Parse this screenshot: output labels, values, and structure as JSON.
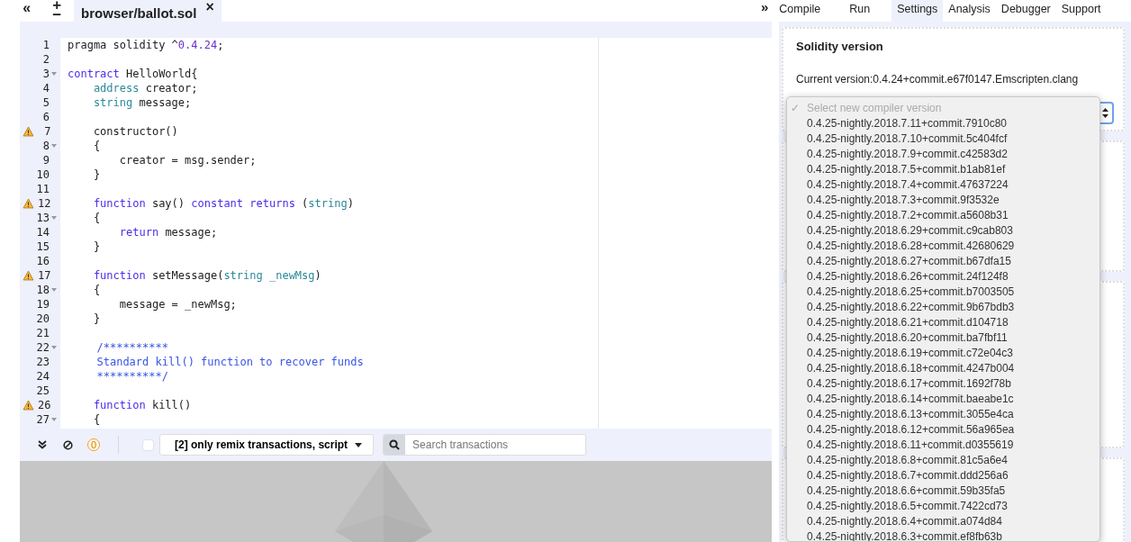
{
  "editor_toolbar": {
    "collapse": "«",
    "add": "+",
    "remove": "−"
  },
  "file_tab": {
    "label": "browser/ballot.sol",
    "close": "×",
    "selected": true
  },
  "code": [
    {
      "number": "1",
      "warning": false,
      "foldable": false,
      "tokens": [
        {
          "kind": "plain",
          "text": "pragma solidity ^"
        },
        {
          "kind": "number",
          "text": "0.4.24"
        },
        {
          "kind": "plain",
          "text": ";"
        }
      ]
    },
    {
      "number": "2",
      "warning": false,
      "foldable": false
    },
    {
      "number": "3",
      "warning": false,
      "foldable": true,
      "tokens": [
        {
          "kind": "keyword",
          "text": "contract"
        },
        {
          "kind": "plain",
          "text": " HelloWorld{"
        }
      ]
    },
    {
      "number": "4",
      "warning": false,
      "foldable": false,
      "tokens": [
        {
          "kind": "type",
          "text": "address"
        },
        {
          "kind": "plain",
          "text": " creator;"
        }
      ]
    },
    {
      "number": "5",
      "warning": false,
      "foldable": false,
      "tokens": [
        {
          "kind": "type",
          "text": "string"
        },
        {
          "kind": "plain",
          "text": " message;"
        }
      ]
    },
    {
      "number": "6",
      "warning": false,
      "foldable": false
    },
    {
      "number": "7",
      "warning": true,
      "foldable": false,
      "tokens": [
        {
          "kind": "plain",
          "text": "constructor()"
        }
      ]
    },
    {
      "number": "8",
      "warning": false,
      "foldable": true,
      "tokens": [
        {
          "kind": "plain",
          "text": "{"
        }
      ]
    },
    {
      "number": "9",
      "warning": false,
      "foldable": false,
      "tokens": [
        {
          "kind": "plain",
          "text": "creator = msg.sender;"
        }
      ]
    },
    {
      "number": "10",
      "warning": false,
      "foldable": false,
      "tokens": [
        {
          "kind": "plain",
          "text": "}"
        }
      ]
    },
    {
      "number": "11",
      "warning": false,
      "foldable": false
    },
    {
      "number": "12",
      "warning": true,
      "foldable": false,
      "tokens": [
        {
          "kind": "keyword",
          "text": "function"
        },
        {
          "kind": "plain",
          "text": " say() "
        },
        {
          "kind": "keyword",
          "text": "constant returns"
        },
        {
          "kind": "plain",
          "text": " ("
        },
        {
          "kind": "type",
          "text": "string"
        },
        {
          "kind": "plain",
          "text": ")"
        }
      ]
    },
    {
      "number": "13",
      "warning": false,
      "foldable": true,
      "tokens": [
        {
          "kind": "plain",
          "text": "{"
        }
      ]
    },
    {
      "number": "14",
      "warning": false,
      "foldable": false,
      "tokens": [
        {
          "kind": "keyword",
          "text": "return"
        },
        {
          "kind": "plain",
          "text": " message;"
        }
      ]
    },
    {
      "number": "15",
      "warning": false,
      "foldable": false,
      "tokens": [
        {
          "kind": "plain",
          "text": "}"
        }
      ]
    },
    {
      "number": "16",
      "warning": false,
      "foldable": false
    },
    {
      "number": "17",
      "warning": true,
      "foldable": false,
      "tokens": [
        {
          "kind": "keyword",
          "text": "function"
        },
        {
          "kind": "plain",
          "text": " setMessage("
        },
        {
          "kind": "type",
          "text": "string _newMsg"
        },
        {
          "kind": "plain",
          "text": ")"
        }
      ]
    },
    {
      "number": "18",
      "warning": false,
      "foldable": true,
      "tokens": [
        {
          "kind": "plain",
          "text": "{"
        }
      ]
    },
    {
      "number": "19",
      "warning": false,
      "foldable": false,
      "tokens": [
        {
          "kind": "plain",
          "text": "message = _newMsg;"
        }
      ]
    },
    {
      "number": "20",
      "warning": false,
      "foldable": false,
      "tokens": [
        {
          "kind": "plain",
          "text": "}"
        }
      ]
    },
    {
      "number": "21",
      "warning": false,
      "foldable": false
    },
    {
      "number": "22",
      "warning": false,
      "foldable": true,
      "tokens": [
        {
          "kind": "comment",
          "text": "/**********"
        }
      ]
    },
    {
      "number": "23",
      "warning": false,
      "foldable": false,
      "tokens": [
        {
          "kind": "comment",
          "text": "Standard kill() function to recover funds"
        }
      ]
    },
    {
      "number": "24",
      "warning": false,
      "foldable": false,
      "tokens": [
        {
          "kind": "comment",
          "text": "**********/"
        }
      ]
    },
    {
      "number": "25",
      "warning": false,
      "foldable": false
    },
    {
      "number": "26",
      "warning": true,
      "foldable": false,
      "tokens": [
        {
          "kind": "keyword",
          "text": "function"
        },
        {
          "kind": "plain",
          "text": " kill()"
        }
      ]
    },
    {
      "number": "27",
      "warning": false,
      "foldable": true,
      "tokens": [
        {
          "kind": "plain",
          "text": "{"
        }
      ]
    }
  ],
  "terminal": {
    "pending_count": "0",
    "only_remix_checked": false,
    "filter": "[2] only remix transactions, script",
    "search": {
      "placeholder": "Search transactions"
    }
  },
  "panel_toggle": "»",
  "tabs": [
    {
      "label": "Compile",
      "selected": false
    },
    {
      "label": "Run",
      "selected": false
    },
    {
      "label": "Settings",
      "selected": true
    },
    {
      "label": "Analysis",
      "selected": false
    },
    {
      "label": "Debugger",
      "selected": false
    },
    {
      "label": "Support",
      "selected": false
    }
  ],
  "settings": {
    "title": "Solidity version",
    "current_version": "Current version:0.4.24+commit.e67f0147.Emscripten.clang"
  },
  "compiler_menu": {
    "check": "✓",
    "options": [
      {
        "label": "Select new compiler version",
        "selected": true
      },
      {
        "label": "0.4.25-nightly.2018.7.11+commit.7910c80",
        "selected": false
      },
      {
        "label": "0.4.25-nightly.2018.7.10+commit.5c404fcf",
        "selected": false
      },
      {
        "label": "0.4.25-nightly.2018.7.9+commit.c42583d2",
        "selected": false
      },
      {
        "label": "0.4.25-nightly.2018.7.5+commit.b1ab81ef",
        "selected": false
      },
      {
        "label": "0.4.25-nightly.2018.7.4+commit.47637224",
        "selected": false
      },
      {
        "label": "0.4.25-nightly.2018.7.3+commit.9f3532e",
        "selected": false
      },
      {
        "label": "0.4.25-nightly.2018.7.2+commit.a5608b31",
        "selected": false
      },
      {
        "label": "0.4.25-nightly.2018.6.29+commit.c9cab803",
        "selected": false
      },
      {
        "label": "0.4.25-nightly.2018.6.28+commit.42680629",
        "selected": false
      },
      {
        "label": "0.4.25-nightly.2018.6.27+commit.b67dfa15",
        "selected": false
      },
      {
        "label": "0.4.25-nightly.2018.6.26+commit.24f124f8",
        "selected": false
      },
      {
        "label": "0.4.25-nightly.2018.6.25+commit.b7003505",
        "selected": false
      },
      {
        "label": "0.4.25-nightly.2018.6.22+commit.9b67bdb3",
        "selected": false
      },
      {
        "label": "0.4.25-nightly.2018.6.21+commit.d104718",
        "selected": false
      },
      {
        "label": "0.4.25-nightly.2018.6.20+commit.ba7fbf11",
        "selected": false
      },
      {
        "label": "0.4.25-nightly.2018.6.19+commit.c72e04c3",
        "selected": false
      },
      {
        "label": "0.4.25-nightly.2018.6.18+commit.4247b004",
        "selected": false
      },
      {
        "label": "0.4.25-nightly.2018.6.17+commit.1692f78b",
        "selected": false
      },
      {
        "label": "0.4.25-nightly.2018.6.14+commit.baeabe1c",
        "selected": false
      },
      {
        "label": "0.4.25-nightly.2018.6.13+commit.3055e4ca",
        "selected": false
      },
      {
        "label": "0.4.25-nightly.2018.6.12+commit.56a965ea",
        "selected": false
      },
      {
        "label": "0.4.25-nightly.2018.6.11+commit.d0355619",
        "selected": false
      },
      {
        "label": "0.4.25-nightly.2018.6.8+commit.81c5a6e4",
        "selected": false
      },
      {
        "label": "0.4.25-nightly.2018.6.7+commit.ddd256a6",
        "selected": false
      },
      {
        "label": "0.4.25-nightly.2018.6.6+commit.59b35fa5",
        "selected": false
      },
      {
        "label": "0.4.25-nightly.2018.6.5+commit.7422cd73",
        "selected": false
      },
      {
        "label": "0.4.25-nightly.2018.6.4+commit.a074d84",
        "selected": false
      },
      {
        "label": "0.4.25-nightly.2018.6.3+commit.ef8fb63b",
        "selected": false
      }
    ]
  }
}
